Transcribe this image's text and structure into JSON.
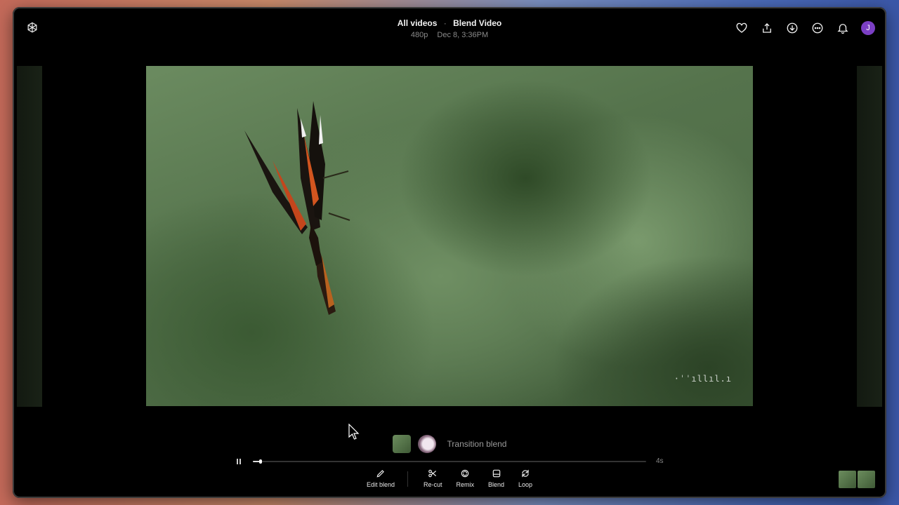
{
  "header": {
    "breadcrumb_root": "All videos",
    "separator": "·",
    "title": "Blend Video",
    "resolution": "480p",
    "timestamp": "Dec 8, 3:36PM",
    "avatar_initial": "J",
    "icons": [
      "openai-logo-icon",
      "heart-icon",
      "share-icon",
      "download-icon",
      "more-icon",
      "bell-icon"
    ]
  },
  "video": {
    "watermark": "·ˈˈıllıl.ı"
  },
  "blend": {
    "label": "Transition blend"
  },
  "playback": {
    "progress": 0.02,
    "duration": "4s"
  },
  "tools": {
    "edit_blend": "Edit blend",
    "recut": "Re-cut",
    "remix": "Remix",
    "blend": "Blend",
    "loop": "Loop"
  },
  "colors": {
    "avatar": "#7b3fc4",
    "background": "#000000"
  }
}
